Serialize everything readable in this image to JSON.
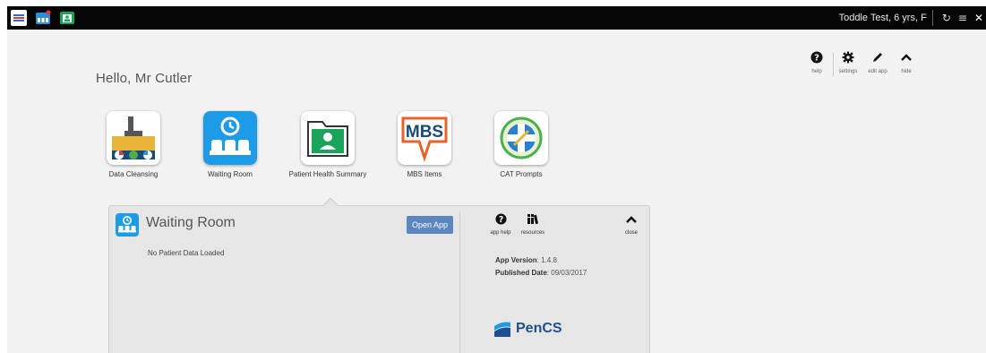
{
  "topbar": {
    "patient_info": "Toddle Test, 6 yrs, F"
  },
  "greeting": "Hello, Mr Cutler",
  "toolbar": {
    "help": "help",
    "settings": "settings",
    "edit_app": "edit app",
    "hide": "hide"
  },
  "apps": [
    {
      "label": "Data Cleansing",
      "icon": "data-cleansing-icon"
    },
    {
      "label": "Waiting Room",
      "icon": "waiting-room-icon",
      "selected": true
    },
    {
      "label": "Patient Health Summary",
      "icon": "patient-health-summary-icon"
    },
    {
      "label": "MBS Items",
      "icon": "mbs-items-icon",
      "icon_text": "MBS"
    },
    {
      "label": "CAT Prompts",
      "icon": "cat-prompts-icon"
    }
  ],
  "detail": {
    "title": "Waiting Room",
    "open_app": "Open App",
    "status": "No Patient Data Loaded",
    "app_help": "app help",
    "resources": "resources",
    "close": "close",
    "version_label": "App Version",
    "version_value": ": 1.4.8",
    "published_label": "Published Date",
    "published_value": ": 09/03/2017",
    "brand": "PenCS"
  },
  "colors": {
    "accent_blue": "#1e9be6",
    "button_blue": "#5b86c0",
    "brand_navy": "#1f4f8f",
    "mbs_orange": "#e8622a",
    "mbs_navy": "#1a4a7a",
    "summary_green": "#1aa35a",
    "cat_green": "#4caf50"
  }
}
